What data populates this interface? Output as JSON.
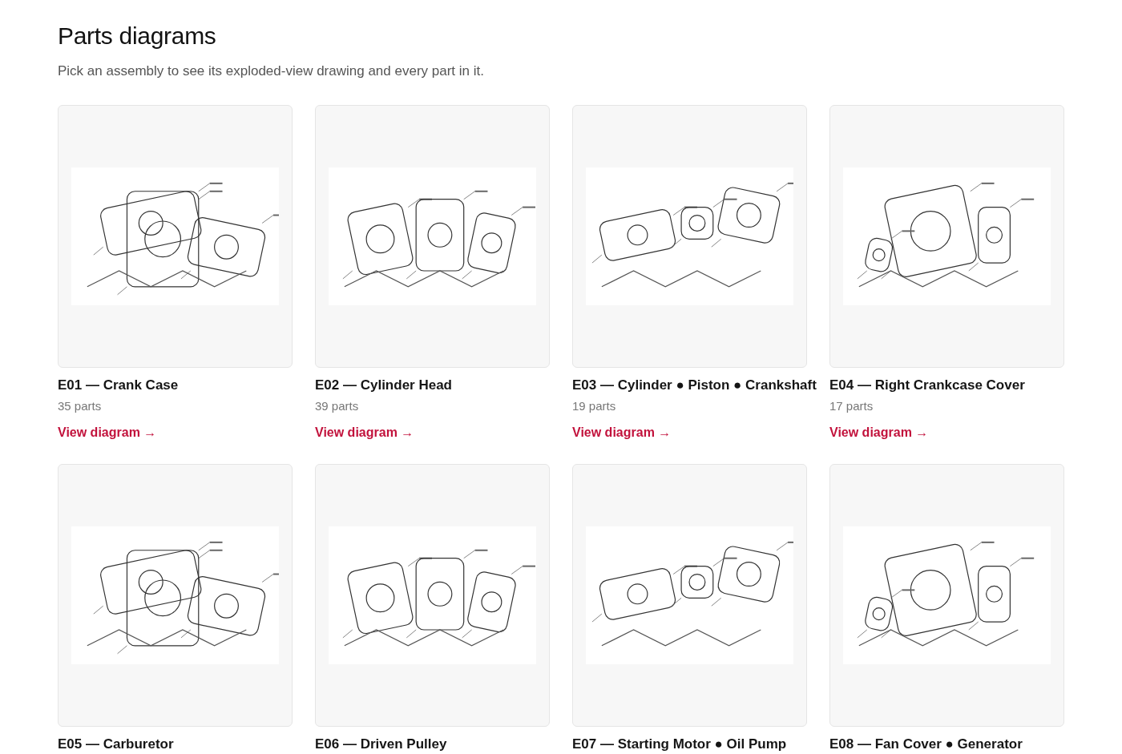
{
  "page": {
    "title": "Parts diagrams",
    "subtitle": "Pick an assembly to see its exploded-view drawing and every part in it."
  },
  "cards": [
    {
      "title": "E01 — Crank Case",
      "parts": "35 parts",
      "link": "View diagram →"
    },
    {
      "title": "E02 — Cylinder Head",
      "parts": "39 parts",
      "link": "View diagram →"
    },
    {
      "title": "E03 — Cylinder ● Piston ● Crankshaft",
      "parts": "19 parts",
      "link": "View diagram →"
    },
    {
      "title": "E04 — Right Crankcase Cover",
      "parts": "17 parts",
      "link": "View diagram →"
    },
    {
      "title": "E05 — Carburetor"
    },
    {
      "title": "E06 — Driven Pulley"
    },
    {
      "title": "E07 — Starting Motor ● Oil Pump"
    },
    {
      "title": "E08 — Fan Cover ● Generator"
    }
  ]
}
